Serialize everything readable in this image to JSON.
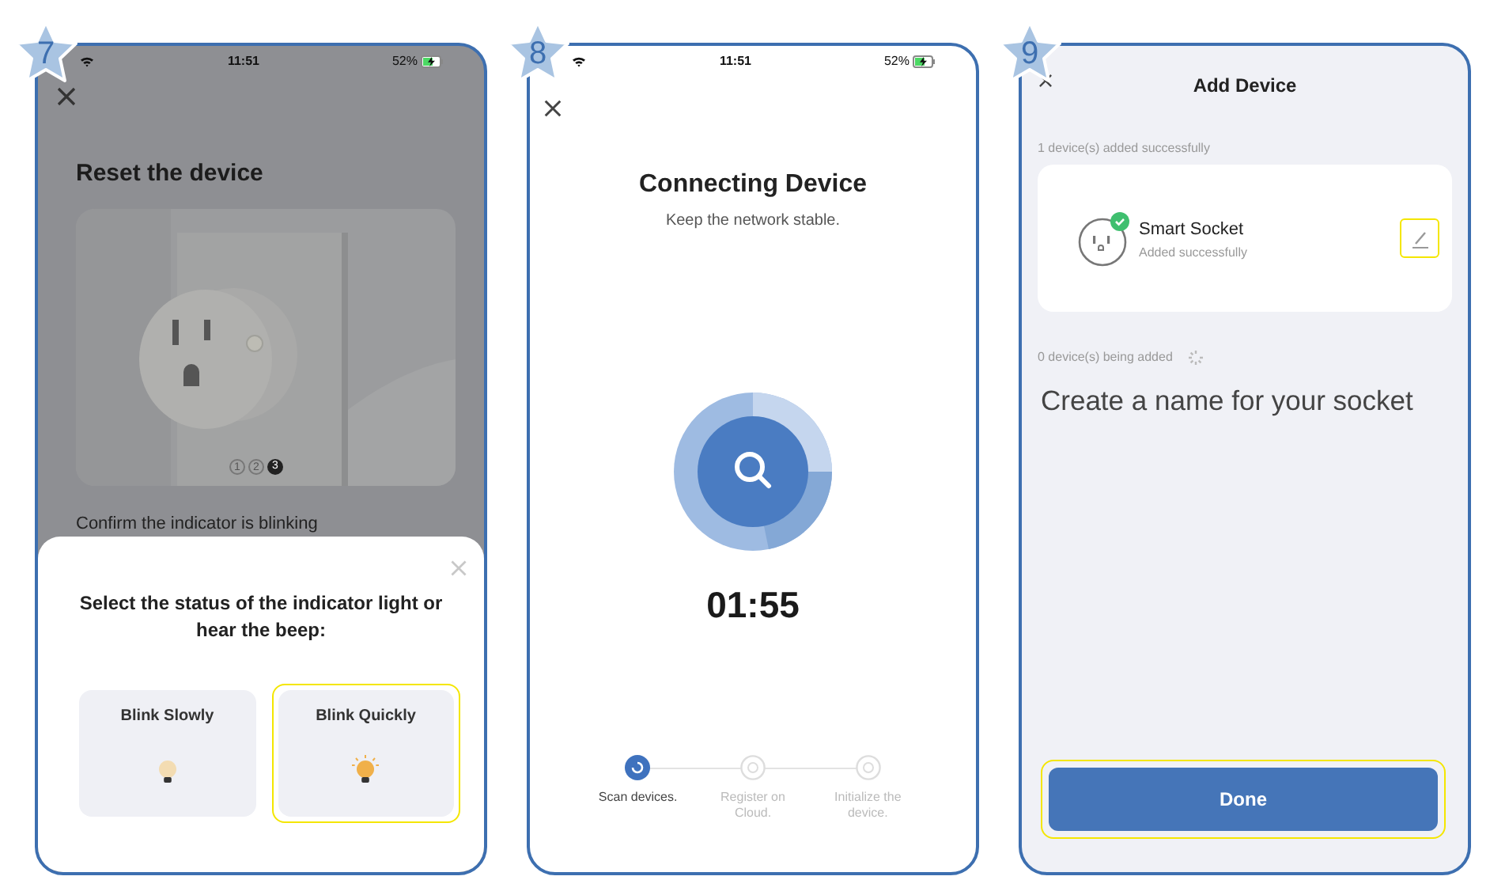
{
  "steps": [
    {
      "kind": "reset",
      "badge": "7",
      "status_bar": {
        "time": "11:51",
        "battery": "52%"
      },
      "title": "Reset the device",
      "pager": [
        {
          "label": "1",
          "selected": false
        },
        {
          "label": "2",
          "selected": false
        },
        {
          "label": "3",
          "selected": true
        }
      ],
      "instruction": "Confirm the indicator is blinking",
      "sheet": {
        "title": "Select the status of the indicator light or hear the beep:",
        "options": [
          {
            "label": "Blink Slowly",
            "kind": "slow",
            "selected": false
          },
          {
            "label": "Blink Quickly",
            "kind": "fast",
            "selected": true
          }
        ]
      }
    },
    {
      "kind": "connecting",
      "badge": "8",
      "status_bar": {
        "time": "11:51",
        "battery": "52%"
      },
      "title": "Connecting Device",
      "subtitle": "Keep the network stable.",
      "timer": "01:55",
      "progress": [
        {
          "label": "Scan devices.",
          "selected": true
        },
        {
          "label": "Register on Cloud.",
          "selected": false
        },
        {
          "label": "Initialize the device.",
          "selected": false
        }
      ]
    },
    {
      "kind": "added",
      "badge": "9",
      "title": "Add Device",
      "added_caption": "1 device(s) added successfully",
      "device": {
        "name": "Smart Socket",
        "status": "Added successfully",
        "edit_highlighted": true
      },
      "pending_caption": "0 device(s) being added",
      "note": "Create a name for your socket",
      "done_button": {
        "label": "Done",
        "highlighted": true
      }
    }
  ]
}
